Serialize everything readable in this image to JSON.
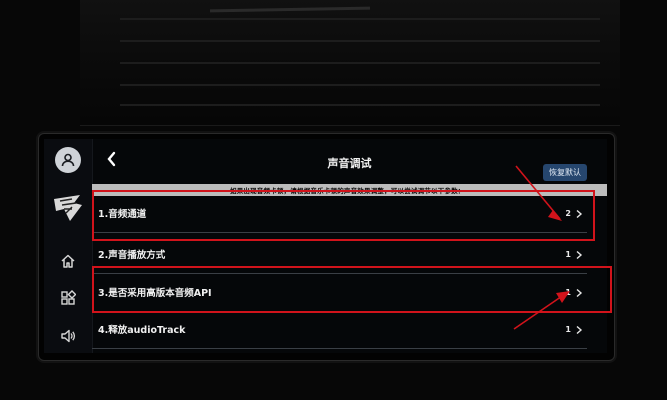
{
  "header": {
    "title": "声音调试",
    "reset_label": "恢复默认"
  },
  "notice": "如果出现音频卡顿，请根据音乐卡顿的声音效果调整，可以尝试调节以下参数：",
  "settings": [
    {
      "label": "1.音频通道",
      "value": "2"
    },
    {
      "label": "2.声音播放方式",
      "value": "1"
    },
    {
      "label": "3.是否采用高版本音频API",
      "value": "1"
    },
    {
      "label": "4.释放audioTrack",
      "value": "1"
    }
  ],
  "sidebar": {
    "items": [
      "user-icon",
      "brand-logo",
      "home-icon",
      "apps-icon",
      "volume-icon"
    ]
  },
  "colors": {
    "annotation": "#d1131b",
    "reset_button": "#26466e",
    "notice_bg": "#bcbcbc"
  }
}
